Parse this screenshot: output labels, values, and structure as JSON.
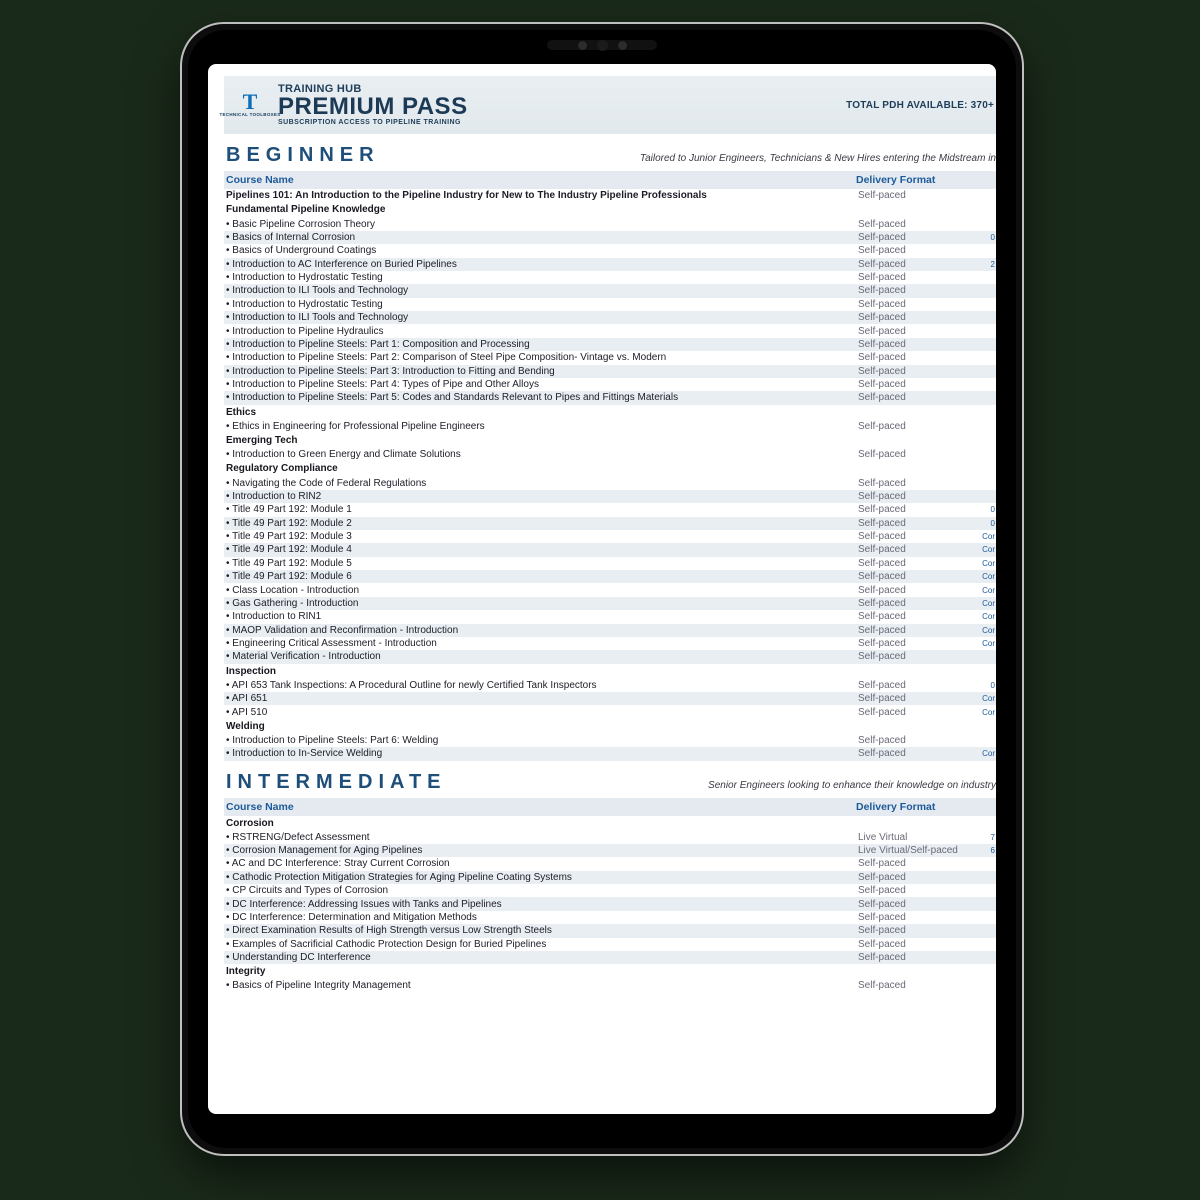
{
  "banner": {
    "logo_top": "T",
    "logo_sub": "TECHNICAL\nTOOLBOXES",
    "over": "TRAINING HUB",
    "main": "PREMIUM PASS",
    "sub": "SUBSCRIPTION ACCESS TO PIPELINE TRAINING",
    "right": "TOTAL PDH AVAILABLE: 370+"
  },
  "levels": [
    {
      "title": "BEGINNER",
      "subtitle": "Tailored to Junior Engineers, Technicians & New Hires entering the Midstream in",
      "headers": {
        "course": "Course Name",
        "format": "Delivery Format"
      },
      "groups": [
        {
          "heading": null,
          "rows": [
            {
              "name": "Pipelines 101: An Introduction to the Pipeline Industry for New to The Industry Pipeline Professionals",
              "format": "Self-paced",
              "extra": "",
              "bold": true
            }
          ]
        },
        {
          "heading": "Fundamental Pipeline Knowledge",
          "rows": [
            {
              "name": "• Basic Pipeline Corrosion Theory",
              "format": "Self-paced",
              "extra": ""
            },
            {
              "name": "• Basics of Internal Corrosion",
              "format": "Self-paced",
              "extra": "0"
            },
            {
              "name": "• Basics of Underground Coatings",
              "format": "Self-paced",
              "extra": ""
            },
            {
              "name": "• Introduction to AC Interference on Buried Pipelines",
              "format": "Self-paced",
              "extra": "2"
            },
            {
              "name": "• Introduction to Hydrostatic Testing",
              "format": "Self-paced",
              "extra": ""
            },
            {
              "name": "• Introduction to ILI Tools and Technology",
              "format": "Self-paced",
              "extra": ""
            },
            {
              "name": "• Introduction to Hydrostatic Testing",
              "format": "Self-paced",
              "extra": ""
            },
            {
              "name": "• Introduction to ILI Tools and Technology",
              "format": "Self-paced",
              "extra": ""
            },
            {
              "name": "• Introduction to Pipeline Hydraulics",
              "format": "Self-paced",
              "extra": ""
            },
            {
              "name": "• Introduction to Pipeline Steels: Part 1: Composition and Processing",
              "format": "Self-paced",
              "extra": ""
            },
            {
              "name": "• Introduction to Pipeline Steels: Part 2: Comparison of Steel Pipe Composition- Vintage vs. Modern",
              "format": "Self-paced",
              "extra": ""
            },
            {
              "name": "• Introduction to Pipeline Steels: Part 3: Introduction to Fitting and Bending",
              "format": "Self-paced",
              "extra": ""
            },
            {
              "name": "• Introduction to Pipeline Steels: Part 4: Types of Pipe and Other Alloys",
              "format": "Self-paced",
              "extra": ""
            },
            {
              "name": "• Introduction to Pipeline Steels: Part 5: Codes and Standards Relevant to Pipes and Fittings Materials",
              "format": "Self-paced",
              "extra": ""
            }
          ]
        },
        {
          "heading": "Ethics",
          "rows": [
            {
              "name": "• Ethics in Engineering for Professional Pipeline Engineers",
              "format": "Self-paced",
              "extra": ""
            }
          ]
        },
        {
          "heading": "Emerging Tech",
          "rows": [
            {
              "name": "• Introduction to Green Energy and Climate Solutions",
              "format": "Self-paced",
              "extra": ""
            }
          ]
        },
        {
          "heading": "Regulatory Compliance",
          "rows": [
            {
              "name": "• Navigating the Code of Federal Regulations",
              "format": "Self-paced",
              "extra": ""
            },
            {
              "name": "• Introduction to RIN2",
              "format": "Self-paced",
              "extra": ""
            },
            {
              "name": "• Title 49 Part 192: Module 1",
              "format": "Self-paced",
              "extra": "0"
            },
            {
              "name": "• Title 49 Part 192: Module 2",
              "format": "Self-paced",
              "extra": "0"
            },
            {
              "name": "• Title 49 Part 192: Module 3",
              "format": "Self-paced",
              "extra": "Cor"
            },
            {
              "name": "• Title 49 Part 192: Module 4",
              "format": "Self-paced",
              "extra": "Cor"
            },
            {
              "name": "• Title 49 Part 192: Module 5",
              "format": "Self-paced",
              "extra": "Cor"
            },
            {
              "name": "• Title 49 Part 192: Module 6",
              "format": "Self-paced",
              "extra": "Cor"
            },
            {
              "name": "• Class Location - Introduction",
              "format": "Self-paced",
              "extra": "Cor"
            },
            {
              "name": "• Gas Gathering - Introduction",
              "format": "Self-paced",
              "extra": "Cor"
            },
            {
              "name": "• Introduction to RIN1",
              "format": "Self-paced",
              "extra": "Cor"
            },
            {
              "name": "• MAOP Validation and Reconfirmation - Introduction",
              "format": "Self-paced",
              "extra": "Cor"
            },
            {
              "name": "• Engineering Critical Assessment - Introduction",
              "format": "Self-paced",
              "extra": "Cor"
            },
            {
              "name": "• Material Verification - Introduction",
              "format": "Self-paced",
              "extra": ""
            }
          ]
        },
        {
          "heading": "Inspection",
          "rows": [
            {
              "name": "• API 653 Tank Inspections: A Procedural Outline for newly Certified Tank Inspectors",
              "format": "Self-paced",
              "extra": "0"
            },
            {
              "name": "• API 651",
              "format": "Self-paced",
              "extra": "Cor"
            },
            {
              "name": "• API 510",
              "format": "Self-paced",
              "extra": "Cor"
            }
          ]
        },
        {
          "heading": "Welding",
          "rows": [
            {
              "name": "• Introduction to Pipeline Steels: Part 6: Welding",
              "format": "Self-paced",
              "extra": ""
            },
            {
              "name": "• Introduction to In-Service Welding",
              "format": "Self-paced",
              "extra": "Cor"
            }
          ]
        }
      ]
    },
    {
      "title": "INTERMEDIATE",
      "subtitle": "Senior Engineers looking to enhance their knowledge on industry",
      "headers": {
        "course": "Course Name",
        "format": "Delivery Format"
      },
      "groups": [
        {
          "heading": "Corrosion",
          "rows": [
            {
              "name": "• RSTRENG/Defect Assessment",
              "format": "Live Virtual",
              "extra": "7"
            },
            {
              "name": "• Corrosion Management for Aging Pipelines",
              "format": "Live Virtual/Self-paced",
              "extra": "6"
            },
            {
              "name": "• AC and DC Interference: Stray Current Corrosion",
              "format": "Self-paced",
              "extra": ""
            },
            {
              "name": "• Cathodic Protection Mitigation Strategies for Aging Pipeline Coating Systems",
              "format": "Self-paced",
              "extra": ""
            },
            {
              "name": "• CP Circuits and Types of Corrosion",
              "format": "Self-paced",
              "extra": ""
            },
            {
              "name": "• DC Interference: Addressing Issues with Tanks and Pipelines",
              "format": "Self-paced",
              "extra": ""
            },
            {
              "name": "• DC Interference: Determination and Mitigation Methods",
              "format": "Self-paced",
              "extra": ""
            },
            {
              "name": "• Direct Examination Results of High Strength versus Low Strength Steels",
              "format": "Self-paced",
              "extra": ""
            },
            {
              "name": "• Examples of Sacrificial Cathodic Protection Design for Buried Pipelines",
              "format": "Self-paced",
              "extra": ""
            },
            {
              "name": "• Understanding DC Interference",
              "format": "Self-paced",
              "extra": ""
            }
          ]
        },
        {
          "heading": "Integrity",
          "rows": [
            {
              "name": "• Basics of Pipeline Integrity Management",
              "format": "Self-paced",
              "extra": ""
            }
          ]
        }
      ]
    }
  ]
}
